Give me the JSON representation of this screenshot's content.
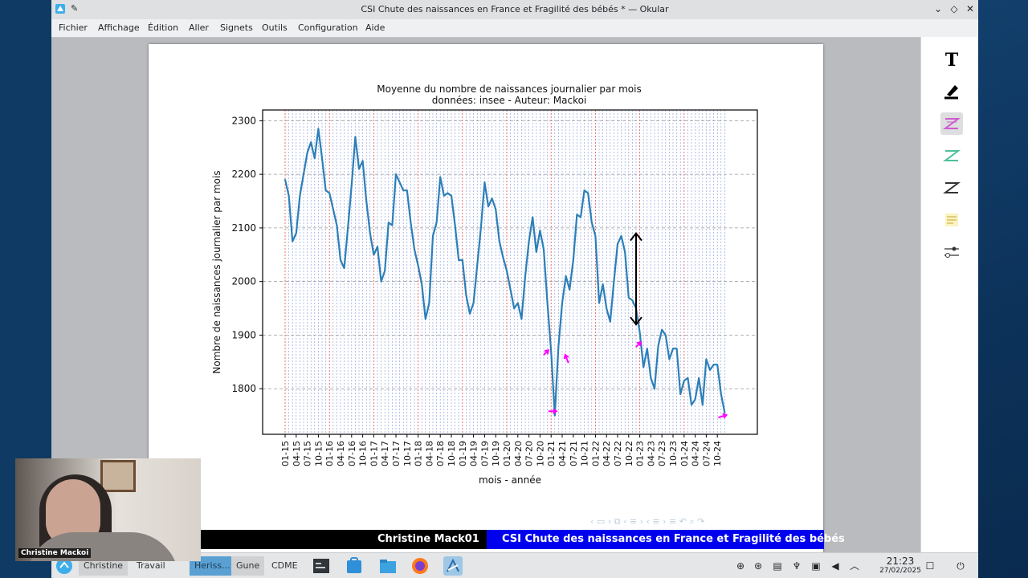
{
  "window": {
    "title": "CSI Chute des naissances en France et Fragilité des bébés * — Okular"
  },
  "menu": [
    "Fichier",
    "Affichage",
    "Édition",
    "Aller",
    "Signets",
    "Outils",
    "Configuration",
    "Aide"
  ],
  "chart_data": {
    "type": "line",
    "title": "Moyenne du nombre de naissances journalier par mois",
    "subtitle": "données: insee - Auteur: Mackoi",
    "xlabel": "mois - année",
    "ylabel": "Nombre de naissances journalier par mois",
    "ylim": [
      1715,
      2320
    ],
    "yticks": [
      1800,
      1900,
      2000,
      2100,
      2200,
      2300
    ],
    "grid": true,
    "xtick_labels": [
      "01-15",
      "04-15",
      "07-15",
      "10-15",
      "01-16",
      "04-16",
      "07-16",
      "10-16",
      "01-17",
      "04-17",
      "07-17",
      "10-17",
      "01-18",
      "04-18",
      "07-18",
      "10-18",
      "01-19",
      "04-19",
      "07-19",
      "10-19",
      "01-20",
      "04-20",
      "07-20",
      "10-20",
      "01-21",
      "04-21",
      "07-21",
      "10-21",
      "01-22",
      "04-22",
      "07-22",
      "10-22",
      "01-23",
      "04-23",
      "07-23",
      "10-23",
      "01-24",
      "04-24",
      "07-24",
      "10-24"
    ],
    "series": [
      {
        "color": "#2c7fb8",
        "values": [
          2190,
          2160,
          2075,
          2090,
          2160,
          2200,
          2240,
          2260,
          2230,
          2285,
          2230,
          2170,
          2165,
          2135,
          2105,
          2040,
          2025,
          2100,
          2180,
          2270,
          2210,
          2225,
          2150,
          2090,
          2050,
          2065,
          2000,
          2020,
          2110,
          2105,
          2200,
          2185,
          2170,
          2170,
          2110,
          2060,
          2030,
          1995,
          1930,
          1960,
          2085,
          2110,
          2195,
          2160,
          2165,
          2160,
          2105,
          2040,
          2040,
          1975,
          1940,
          1960,
          2030,
          2100,
          2185,
          2140,
          2155,
          2135,
          2075,
          2045,
          2020,
          1985,
          1950,
          1960,
          1930,
          2010,
          2075,
          2120,
          2055,
          2095,
          2060,
          1960,
          1870,
          1750,
          1880,
          1960,
          2010,
          1985,
          2040,
          2125,
          2120,
          2170,
          2165,
          2110,
          2085,
          1960,
          1995,
          1950,
          1925,
          2000,
          2070,
          2085,
          2055,
          1970,
          1965,
          1950,
          1905,
          1840,
          1875,
          1820,
          1800,
          1880,
          1910,
          1900,
          1855,
          1875,
          1875,
          1790,
          1815,
          1820,
          1770,
          1780,
          1820,
          1770,
          1855,
          1835,
          1845,
          1845,
          1790,
          1755
        ]
      }
    ],
    "month_line_colors": {
      "january": "#d62728",
      "other": "#1f3fbf"
    },
    "annotation_arrows": [
      {
        "month_index": 95,
        "from": 2090,
        "to": 1920,
        "color": "#000000",
        "double_headed": true
      }
    ],
    "marker_arrows_color": "#ff00ff"
  },
  "banner": {
    "author": "Christine Mack01",
    "title": "CSI Chute des naissances en France et Fragilité des bébés"
  },
  "webcam": {
    "name": "Christine Mackoi"
  },
  "taskbar": {
    "tasks": [
      "Christine",
      "Travail",
      "Heriss...",
      "Gune",
      "CDME"
    ],
    "time": "21:23",
    "date": "27/02/2025"
  },
  "sidebar_tools": [
    "text-tool-icon",
    "highlight-pen-icon",
    "pink-line-icon",
    "green-line-icon",
    "black-line-icon",
    "yellow-note-icon",
    "slider-settings-icon"
  ]
}
